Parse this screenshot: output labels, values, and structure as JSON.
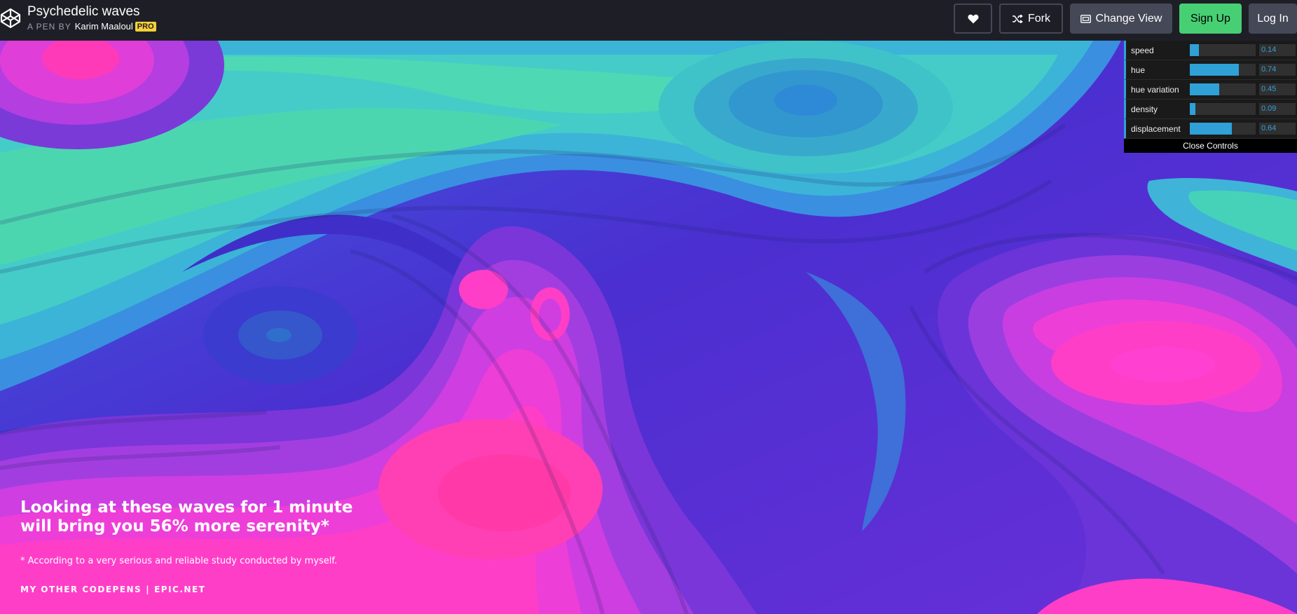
{
  "header": {
    "title": "Psychedelic waves",
    "by_label": "A PEN BY",
    "author": "Karim Maaloul",
    "badge": "PRO",
    "buttons": {
      "heart_icon": "heart-icon",
      "fork_label": "Fork",
      "change_view_label": "Change View",
      "signup_label": "Sign Up",
      "login_label": "Log In"
    }
  },
  "controls": {
    "items": [
      {
        "label": "speed",
        "value": "0.14",
        "fraction": 0.14
      },
      {
        "label": "hue",
        "value": "0.74",
        "fraction": 0.74
      },
      {
        "label": "hue variation",
        "value": "0.45",
        "fraction": 0.45
      },
      {
        "label": "density",
        "value": "0.09",
        "fraction": 0.09
      },
      {
        "label": "displacement",
        "value": "0.64",
        "fraction": 0.64
      }
    ],
    "close_label": "Close Controls"
  },
  "overlay": {
    "headline_line1": "Looking at these waves for 1 minute",
    "headline_line2": "will bring you 56% more serenity*",
    "footnote": "* According to a very serious and reliable study conducted by myself.",
    "link_codepens": "MY OTHER CODEPENS",
    "link_separator": "|",
    "link_epic": "EPIC.NET"
  },
  "colors": {
    "accent_blue": "#2fa1d6",
    "signup_green": "#47cf73",
    "pro_yellow": "#f7d136",
    "wave_pink": "#ff3ec8",
    "wave_cyan": "#3fd6c0",
    "wave_violet": "#4b2fd0"
  }
}
